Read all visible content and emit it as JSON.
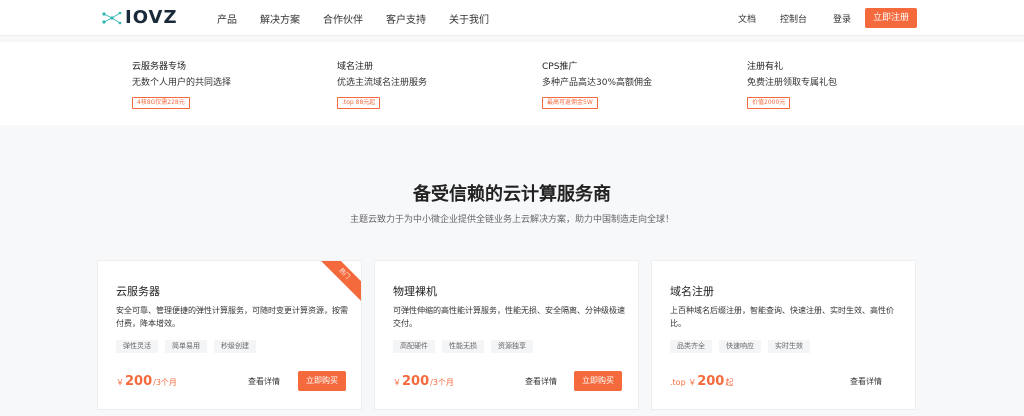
{
  "brand": {
    "logo_text": "IOVZ"
  },
  "nav": {
    "links": [
      "产品",
      "解决方案",
      "合作伙伴",
      "客户支持",
      "关于我们"
    ],
    "docs": "文档",
    "console": "控制台",
    "login": "登录",
    "register": "立即注册"
  },
  "promos": [
    {
      "title": "云服务器专场",
      "desc": "无数个人用户的共同选择",
      "tag": "4核8G仅需228元"
    },
    {
      "title": "域名注册",
      "desc": "优选主流域名注册服务",
      "tag": ".top 88元起"
    },
    {
      "title": "CPS推广",
      "desc": "多种产品高达30%高额佣金",
      "tag": "最高可返佣金5W"
    },
    {
      "title": "注册有礼",
      "desc": "免费注册领取专属礼包",
      "tag": "价值2000元"
    }
  ],
  "hero": {
    "title": "备受信赖的云计算服务商",
    "subtitle": "主题云致力于为中小微企业提供全链业务上云解决方案，助力中国制造走向全球！"
  },
  "cards": [
    {
      "title": "云服务器",
      "desc": "安全可靠、管理便捷的弹性计算服务，可随时变更计算资源，按需付费，降本增效。",
      "tags": [
        "弹性灵活",
        "简单易用",
        "秒级创建"
      ],
      "price_prefix": "￥",
      "price": "200",
      "price_suffix": "/3个月",
      "detail": "查看详情",
      "buy": "立即购买",
      "ribbon": "热门"
    },
    {
      "title": "物理裸机",
      "desc": "可弹性伸缩的高性能计算服务，性能无损、安全隔离、分钟级极速交付。",
      "tags": [
        "高配硬件",
        "性能无损",
        "资源独享"
      ],
      "price_prefix": "￥",
      "price": "200",
      "price_suffix": "/3个月",
      "detail": "查看详情",
      "buy": "立即购买"
    },
    {
      "title": "域名注册",
      "desc": "上百种域名后缀注册，智能查询、快速注册、实时生效、高性价比。",
      "tags": [
        "品类齐全",
        "快速响应",
        "实时生效"
      ],
      "price_prefix": ".top ￥",
      "price": "200",
      "price_suffix": "起",
      "detail": "查看详情"
    }
  ],
  "colors": {
    "accent": "#f46a3c",
    "logo_icon": "#2fb5b0"
  }
}
